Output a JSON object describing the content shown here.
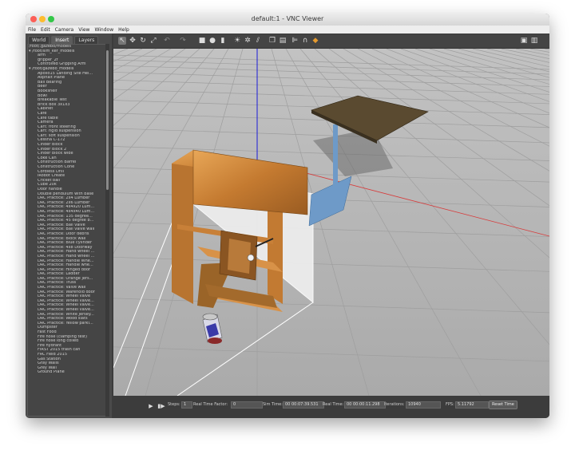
{
  "window": {
    "title": "default:1 - VNC Viewer"
  },
  "menu": [
    "File",
    "Edit",
    "Camera",
    "View",
    "Window",
    "Help"
  ],
  "tabs": [
    "World",
    "Insert",
    "Layers"
  ],
  "tree": [
    {
      "label": "/root/.gazebo/models",
      "level": 0
    },
    {
      "label": "▾ /root/sim_ker_models",
      "level": 0
    },
    {
      "label": "arm",
      "level": 1
    },
    {
      "label": "gripper_2f",
      "level": 1
    },
    {
      "label": "Controlled Gripping Arm",
      "level": 1
    },
    {
      "label": "▾ /root/gazebo_models",
      "level": 0
    },
    {
      "label": "Apollo15 Landing Site Hei...",
      "level": 1
    },
    {
      "label": "Asphalt Plane",
      "level": 1
    },
    {
      "label": "Ball Bearing",
      "level": 1
    },
    {
      "label": "Beer",
      "level": 1
    },
    {
      "label": "Bookshelf",
      "level": 1
    },
    {
      "label": "Bowl",
      "level": 1
    },
    {
      "label": "Breakable Test",
      "level": 1
    },
    {
      "label": "Brick Box 3x1x3",
      "level": 1
    },
    {
      "label": "Cabinet",
      "level": 1
    },
    {
      "label": "Cafe",
      "level": 1
    },
    {
      "label": "Cafe table",
      "level": 1
    },
    {
      "label": "Camera",
      "level": 1
    },
    {
      "label": "Cart: front steering",
      "level": 1
    },
    {
      "label": "Cart: rigid suspension",
      "level": 1
    },
    {
      "label": "Cart: soft suspension",
      "level": 1
    },
    {
      "label": "Cessna C-172",
      "level": 1
    },
    {
      "label": "Cinder Block",
      "level": 1
    },
    {
      "label": "Cinder Block 2",
      "level": 1
    },
    {
      "label": "Cinder block wide",
      "level": 1
    },
    {
      "label": "Coke Can",
      "level": 1
    },
    {
      "label": "Construction Barrel",
      "level": 1
    },
    {
      "label": "Construction Cone",
      "level": 1
    },
    {
      "label": "Cordless Drill",
      "level": 1
    },
    {
      "label": "iRobot Create",
      "level": 1
    },
    {
      "label": "Cricket ball",
      "level": 1
    },
    {
      "label": "Cube 20k",
      "level": 1
    },
    {
      "label": "Door handle",
      "level": 1
    },
    {
      "label": "Double pendulum with base",
      "level": 1
    },
    {
      "label": "DRC Practice: 2x4 Lumber",
      "level": 1
    },
    {
      "label": "DRC Practice: 2x6 Lumber",
      "level": 1
    },
    {
      "label": "DRC Practice: 4x4x20 Lum...",
      "level": 1
    },
    {
      "label": "DRC Practice: 4x4x40 Lum...",
      "level": 1
    },
    {
      "label": "DRC Practice: 135 degree...",
      "level": 1
    },
    {
      "label": "DRC Practice: 45 degree b...",
      "level": 1
    },
    {
      "label": "DRC Practice: Ball valve",
      "level": 1
    },
    {
      "label": "DRC Practice: Ball valve wall",
      "level": 1
    },
    {
      "label": "DRC Practice: Door debris",
      "level": 1
    },
    {
      "label": "DRC Practice: Block wall",
      "level": 1
    },
    {
      "label": "DRC Practice: Blue cylinder",
      "level": 1
    },
    {
      "label": "DRC Practice: 4x8 Doorway",
      "level": 1
    },
    {
      "label": "DRC Practice: Hand wheel ...",
      "level": 1
    },
    {
      "label": "DRC Practice: Hand wheel ...",
      "level": 1
    },
    {
      "label": "DRC Practice: Handle Whe...",
      "level": 1
    },
    {
      "label": "DRC Practice: Handle whe...",
      "level": 1
    },
    {
      "label": "DRC Practice: Hinged door",
      "level": 1
    },
    {
      "label": "DRC Practice: Ladder",
      "level": 1
    },
    {
      "label": "DRC Practice: Orange jers...",
      "level": 1
    },
    {
      "label": "DRC Practice: Truss",
      "level": 1
    },
    {
      "label": "DRC Practice: Valve wall",
      "level": 1
    },
    {
      "label": "DRC Practice: Warehold door",
      "level": 1
    },
    {
      "label": "DRC Practice: Wheel valve",
      "level": 1
    },
    {
      "label": "DRC Practice: Wheel valve...",
      "level": 1
    },
    {
      "label": "DRC Practice: Wheel valve...",
      "level": 1
    },
    {
      "label": "DRC Practice: Wheel valve...",
      "level": 1
    },
    {
      "label": "DRC Practice: White Jersey...",
      "level": 1
    },
    {
      "label": "DRC Practice: Wood slats",
      "level": 1
    },
    {
      "label": "DRC Practice: Yellow parki...",
      "level": 1
    },
    {
      "label": "Dumpster",
      "level": 1
    },
    {
      "label": "Fast Food",
      "level": 1
    },
    {
      "label": "Fire hose (clamping test)",
      "level": 1
    },
    {
      "label": "Fire hose long coiled",
      "level": 1
    },
    {
      "label": "Fire hydrant",
      "level": 1
    },
    {
      "label": "FIRST 2015 trash can",
      "level": 1
    },
    {
      "label": "FRC Field 2015",
      "level": 1
    },
    {
      "label": "Gas Station",
      "level": 1
    },
    {
      "label": "Gray Walls",
      "level": 1
    },
    {
      "label": "Grey Wall",
      "level": 1
    },
    {
      "label": "Ground Plane",
      "level": 1
    }
  ],
  "bottom": {
    "steps_label": "Steps:",
    "steps_value": "1",
    "rtf_label": "Real Time Factor:",
    "rtf_value": "0",
    "simtime_label": "Sim Time:",
    "simtime_value": "00 00:07:39.531",
    "realtime_label": "Real Time:",
    "realtime_value": "00 00:00:11.298",
    "iterations_label": "Iterations:",
    "iterations_value": "10940",
    "fps_label": "FPS:",
    "fps_value": "5.11792",
    "reset_label": "Reset Time"
  },
  "colors": {
    "viewport": "#b8b8b8",
    "panel": "#4a4a4a",
    "axis_z": "#1a1ad8",
    "axis_x": "#d83a3a"
  }
}
